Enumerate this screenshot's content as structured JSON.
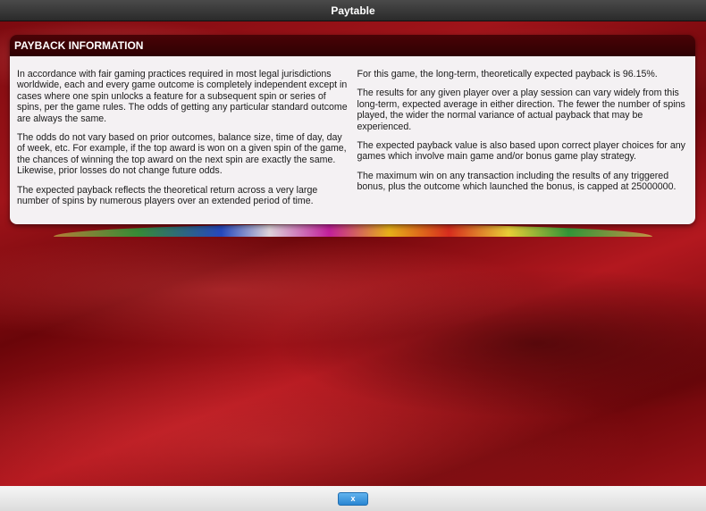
{
  "window": {
    "title": "Paytable"
  },
  "panel": {
    "heading": "PAYBACK INFORMATION",
    "left_paragraphs": [
      "In accordance with fair gaming practices required in most legal jurisdictions worldwide, each and every game outcome is completely independent except in cases where one spin unlocks a feature for a subsequent spin or series of spins, per the game rules. The odds of getting any particular standard outcome are always the same.",
      "The odds do not vary based on prior outcomes, balance size, time of day, day of week, etc. For example, if the top award is won on a given spin of the game, the chances of winning the top award on the next spin are exactly the same. Likewise, prior losses do not change future odds.",
      "The expected payback reflects the theoretical return across a very large number of spins by numerous players over an extended period of time."
    ],
    "right_paragraphs": [
      "For this game, the long-term, theoretically expected payback is 96.15%.",
      "The results for any given player over a play session can vary widely from this long-term, expected average in either direction. The fewer the number of spins played, the wider the normal variance of actual payback that may be experienced.",
      "The expected payback value is also based upon correct player choices for any games which involve main game and/or bonus game play strategy.",
      "The maximum win on any transaction including the results of any triggered bonus, plus the outcome which launched the bonus, is capped at 25000000."
    ]
  },
  "footer": {
    "close_label": "x"
  }
}
